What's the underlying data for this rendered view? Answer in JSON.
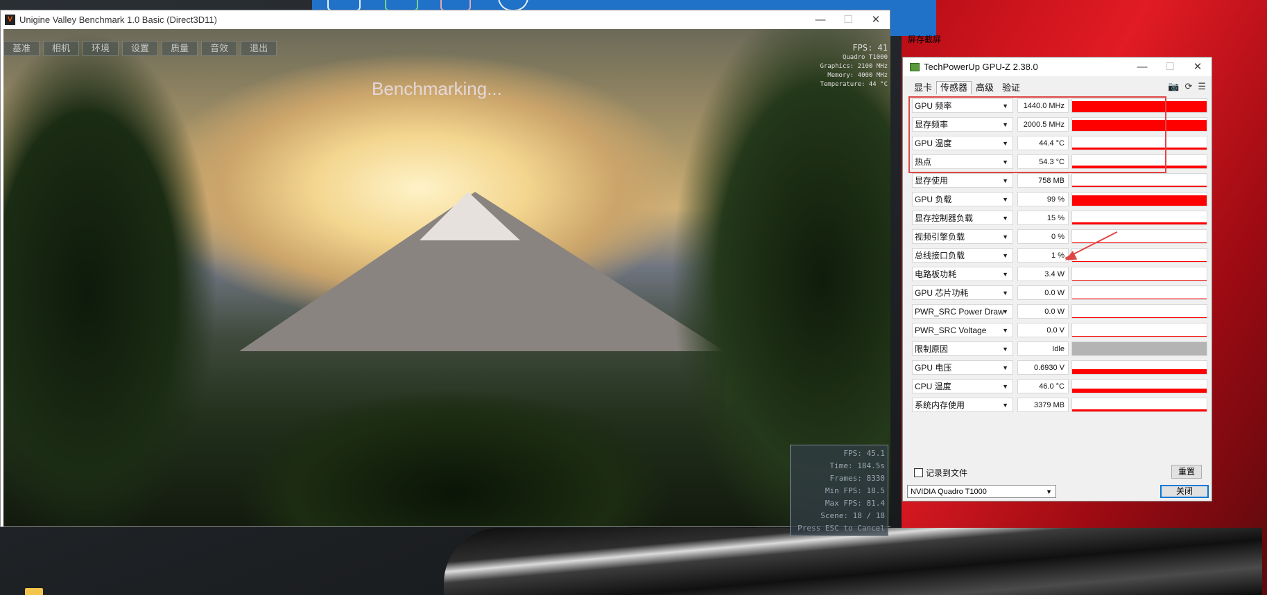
{
  "desktop": {
    "partial_text": "屏存截屏"
  },
  "valley": {
    "title": "Unigine Valley Benchmark 1.0 Basic (Direct3D11)",
    "menu": [
      "基准",
      "相机",
      "环境",
      "设置",
      "质量",
      "音效",
      "退出"
    ],
    "benchmarking": "Benchmarking...",
    "hud": {
      "fps": "FPS: 41",
      "gpu": "Quadro T1000",
      "graphics_clock": "Graphics: 2100 MHz",
      "memory_clock": "Memory: 4000 MHz",
      "temperature": "Temperature: 44 °C"
    },
    "stats": {
      "fps": "FPS: 45.1",
      "time": "Time: 184.5s",
      "frames": "Frames: 8330",
      "min_fps": "Min FPS: 18.5",
      "max_fps": "Max FPS: 81.4",
      "scene": "Scene: 18 / 18",
      "esc": "Press ESC to Cancel"
    }
  },
  "gpuz": {
    "title": "TechPowerUp GPU-Z 2.38.0",
    "tabs": [
      "显卡",
      "传感器",
      "高级",
      "验证"
    ],
    "active_tab": "传感器",
    "sensors": [
      {
        "label": "GPU 频率",
        "value": "1440.0 MHz",
        "level": 0.85
      },
      {
        "label": "显存频率",
        "value": "2000.5 MHz",
        "level": 0.85
      },
      {
        "label": "GPU 温度",
        "value": "44.4 °C",
        "level": 0.15
      },
      {
        "label": "热点",
        "value": "54.3 °C",
        "level": 0.2
      },
      {
        "label": "显存使用",
        "value": "758 MB",
        "level": 0.1
      },
      {
        "label": "GPU 负载",
        "value": "99 %",
        "level": 0.8
      },
      {
        "label": "显存控制器负载",
        "value": "15 %",
        "level": 0.15
      },
      {
        "label": "视频引擎负载",
        "value": "0 %",
        "level": 0
      },
      {
        "label": "总线接口负载",
        "value": "1 %",
        "level": 0.05
      },
      {
        "label": "电路板功耗",
        "value": "3.4 W",
        "level": 0.05
      },
      {
        "label": "GPU 芯片功耗",
        "value": "0.0 W",
        "level": 0
      },
      {
        "label": "PWR_SRC Power Draw",
        "value": "0.0 W",
        "level": 0
      },
      {
        "label": "PWR_SRC Voltage",
        "value": "0.0 V",
        "level": 0
      },
      {
        "label": "限制原因",
        "value": "Idle",
        "level": 1,
        "color": "#b4b4b4"
      },
      {
        "label": "GPU 电压",
        "value": "0.6930 V",
        "level": 0.35
      },
      {
        "label": "CPU 温度",
        "value": "46.0 °C",
        "level": 0.3
      },
      {
        "label": "系统内存使用",
        "value": "3379 MB",
        "level": 0.15
      }
    ],
    "log_to_file": "记录到文件",
    "reset": "重置",
    "gpu_select": "NVIDIA Quadro T1000",
    "close": "关闭"
  },
  "colors": {
    "graph_fill": "#ff0000",
    "annotation": "#e04545"
  }
}
